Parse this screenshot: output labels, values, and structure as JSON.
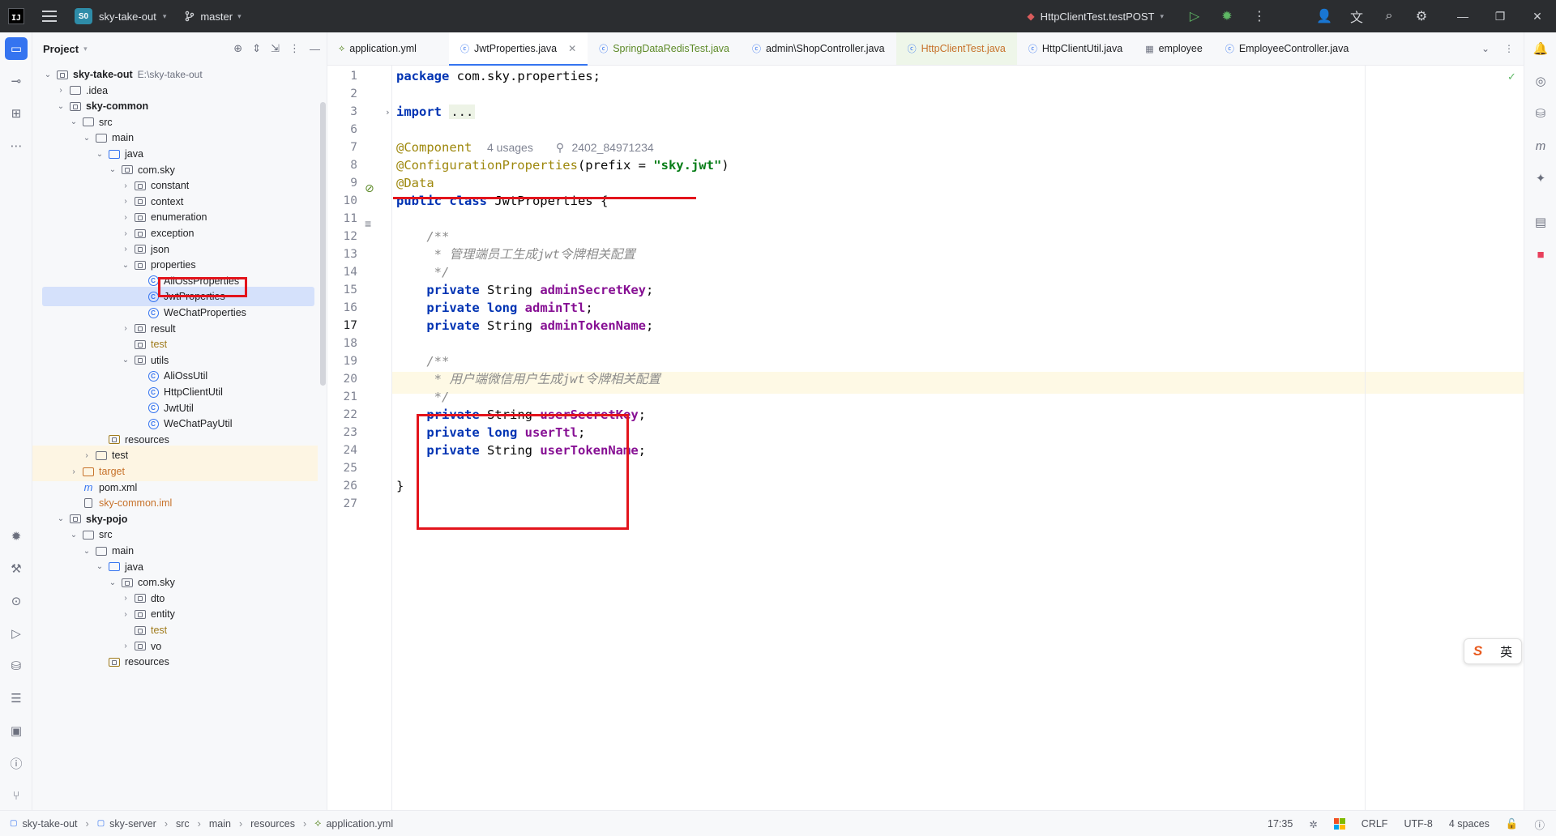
{
  "titlebar": {
    "project_badge": "S0",
    "project_name": "sky-take-out",
    "branch": "master",
    "run_config": "HttpClientTest.testPOST"
  },
  "project_panel": {
    "title": "Project",
    "tree": [
      {
        "label": "sky-take-out",
        "path": "E:\\sky-take-out",
        "level": 0,
        "arrow": "open",
        "icon": "module-folder",
        "bold": true
      },
      {
        "label": ".idea",
        "level": 1,
        "arrow": "closed",
        "icon": "folder"
      },
      {
        "label": "sky-common",
        "level": 1,
        "arrow": "open",
        "icon": "module-folder",
        "bold": true
      },
      {
        "label": "src",
        "level": 2,
        "arrow": "open",
        "icon": "folder"
      },
      {
        "label": "main",
        "level": 3,
        "arrow": "open",
        "icon": "folder"
      },
      {
        "label": "java",
        "level": 4,
        "arrow": "open",
        "icon": "source-folder"
      },
      {
        "label": "com.sky",
        "level": 5,
        "arrow": "open",
        "icon": "package"
      },
      {
        "label": "constant",
        "level": 6,
        "arrow": "closed",
        "icon": "package"
      },
      {
        "label": "context",
        "level": 6,
        "arrow": "closed",
        "icon": "package"
      },
      {
        "label": "enumeration",
        "level": 6,
        "arrow": "closed",
        "icon": "package"
      },
      {
        "label": "exception",
        "level": 6,
        "arrow": "closed",
        "icon": "package"
      },
      {
        "label": "json",
        "level": 6,
        "arrow": "closed",
        "icon": "package"
      },
      {
        "label": "properties",
        "level": 6,
        "arrow": "open",
        "icon": "package"
      },
      {
        "label": "AliOssProperties",
        "level": 7,
        "arrow": "none",
        "icon": "class"
      },
      {
        "label": "JwtProperties",
        "level": 7,
        "arrow": "none",
        "icon": "class",
        "selected": true
      },
      {
        "label": "WeChatProperties",
        "level": 7,
        "arrow": "none",
        "icon": "class"
      },
      {
        "label": "result",
        "level": 6,
        "arrow": "closed",
        "icon": "package"
      },
      {
        "label": "test",
        "level": 6,
        "arrow": "none",
        "icon": "package",
        "color": "gold"
      },
      {
        "label": "utils",
        "level": 6,
        "arrow": "open",
        "icon": "package"
      },
      {
        "label": "AliOssUtil",
        "level": 7,
        "arrow": "none",
        "icon": "class"
      },
      {
        "label": "HttpClientUtil",
        "level": 7,
        "arrow": "none",
        "icon": "class"
      },
      {
        "label": "JwtUtil",
        "level": 7,
        "arrow": "none",
        "icon": "class"
      },
      {
        "label": "WeChatPayUtil",
        "level": 7,
        "arrow": "none",
        "icon": "class"
      },
      {
        "label": "resources",
        "level": 4,
        "arrow": "none",
        "icon": "resources-folder"
      },
      {
        "label": "test",
        "level": 3,
        "arrow": "closed",
        "icon": "folder",
        "highlight": true
      },
      {
        "label": "target",
        "level": 2,
        "arrow": "closed",
        "icon": "folder",
        "highlight": true,
        "color": "orange"
      },
      {
        "label": "pom.xml",
        "level": 2,
        "arrow": "none",
        "icon": "maven"
      },
      {
        "label": "sky-common.iml",
        "level": 2,
        "arrow": "none",
        "icon": "iml",
        "color": "orange"
      },
      {
        "label": "sky-pojo",
        "level": 1,
        "arrow": "open",
        "icon": "module-folder",
        "bold": true
      },
      {
        "label": "src",
        "level": 2,
        "arrow": "open",
        "icon": "folder"
      },
      {
        "label": "main",
        "level": 3,
        "arrow": "open",
        "icon": "folder"
      },
      {
        "label": "java",
        "level": 4,
        "arrow": "open",
        "icon": "source-folder"
      },
      {
        "label": "com.sky",
        "level": 5,
        "arrow": "open",
        "icon": "package"
      },
      {
        "label": "dto",
        "level": 6,
        "arrow": "closed",
        "icon": "package"
      },
      {
        "label": "entity",
        "level": 6,
        "arrow": "closed",
        "icon": "package"
      },
      {
        "label": "test",
        "level": 6,
        "arrow": "none",
        "icon": "package",
        "color": "gold"
      },
      {
        "label": "vo",
        "level": 6,
        "arrow": "closed",
        "icon": "package"
      },
      {
        "label": "resources",
        "level": 4,
        "arrow": "none",
        "icon": "resources-folder"
      }
    ]
  },
  "tabs": [
    {
      "label": "application.yml",
      "icon": "yaml-icon",
      "style": "normal"
    },
    {
      "label": "JwtProperties.java",
      "icon": "class-icon",
      "style": "active"
    },
    {
      "label": "SpringDataRedisTest.java",
      "icon": "class-icon",
      "style": "green"
    },
    {
      "label": "admin\\ShopController.java",
      "icon": "class-icon",
      "style": "normal"
    },
    {
      "label": "HttpClientTest.java",
      "icon": "class-icon",
      "style": "orange"
    },
    {
      "label": "HttpClientUtil.java",
      "icon": "class-icon",
      "style": "normal"
    },
    {
      "label": "employee",
      "icon": "table-icon",
      "style": "normal"
    },
    {
      "label": "EmployeeController.java",
      "icon": "class-icon",
      "style": "normal"
    }
  ],
  "editor": {
    "line_numbers": [
      "1",
      "2",
      "3",
      "6",
      "7",
      "8",
      "9",
      "10",
      "11",
      "12",
      "13",
      "14",
      "15",
      "16",
      "17",
      "18",
      "19",
      "20",
      "21",
      "22",
      "23",
      "24",
      "25",
      "26",
      "27"
    ],
    "current_line": "17",
    "code": {
      "l1_kw": "package",
      "l1_rest": " com.sky.properties;",
      "l3_kw": "import",
      "l3_dots": "...",
      "l7_ann": "@Component",
      "l7_hint": "4 usages",
      "l7_author": "2402_84971234",
      "l8_ann": "@ConfigurationProperties",
      "l8_mid": "(prefix = ",
      "l8_str": "\"sky.jwt\"",
      "l8_end": ")",
      "l9_ann": "@Data",
      "l10_kw": "public class",
      "l10_rest": " JwtProperties {",
      "l12": "    /**",
      "l13": "     * 管理端员工生成jwt令牌相关配置",
      "l14": "     */",
      "private": "private",
      "string": "String",
      "long": "long",
      "f_admin_secret": "adminSecretKey",
      "f_admin_ttl": "adminTtl",
      "f_admin_token": "adminTokenName",
      "l19": "    /**",
      "l20": "     * 用户端微信用户生成jwt令牌相关配置",
      "l21": "     */",
      "f_user_secret": "userSecretKey",
      "f_user_ttl": "userTtl",
      "f_user_token": "userTokenName",
      "semicolon": ";",
      "l26": "}"
    }
  },
  "ime": {
    "label": "英"
  },
  "statusbar": {
    "breadcrumb": [
      "sky-take-out",
      "sky-server",
      "src",
      "main",
      "resources",
      "application.yml"
    ],
    "position": "17:35",
    "line_sep": "CRLF",
    "encoding": "UTF-8",
    "indent": "4 spaces"
  }
}
